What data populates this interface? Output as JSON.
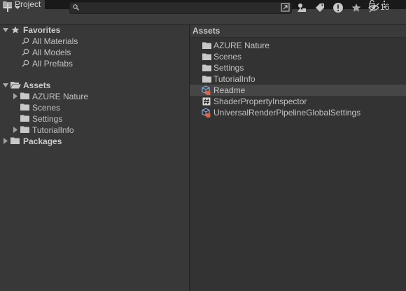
{
  "window": {
    "tab_title": "Project"
  },
  "toolbar": {
    "search": {
      "value": "",
      "placeholder": ""
    },
    "hidden_count": "16"
  },
  "favorites": {
    "header": "Favorites",
    "items": [
      "All Materials",
      "All Models",
      "All Prefabs"
    ]
  },
  "assets_tree": {
    "header": "Assets",
    "children": [
      "AZURE Nature",
      "Scenes",
      "Settings",
      "TutorialInfo"
    ]
  },
  "packages": {
    "header": "Packages"
  },
  "right_panel": {
    "breadcrumb": "Assets",
    "items": [
      {
        "name": "AZURE Nature",
        "icon": "folder-icon"
      },
      {
        "name": "Scenes",
        "icon": "folder-icon"
      },
      {
        "name": "Settings",
        "icon": "folder-icon"
      },
      {
        "name": "TutorialInfo",
        "icon": "folder-icon"
      },
      {
        "name": "Readme",
        "icon": "scriptable-object-icon"
      },
      {
        "name": "ShaderPropertyInspector",
        "icon": "csharp-script-icon"
      },
      {
        "name": "UniversalRenderPipelineGlobalSettings",
        "icon": "scriptable-object-icon"
      }
    ]
  },
  "colors": {
    "background": "#282828",
    "left_panel": "#383838",
    "right_panel": "#333333",
    "toolbar": "#3c3c3c",
    "selected_row": "#464646",
    "text": "#c4c4c4"
  }
}
